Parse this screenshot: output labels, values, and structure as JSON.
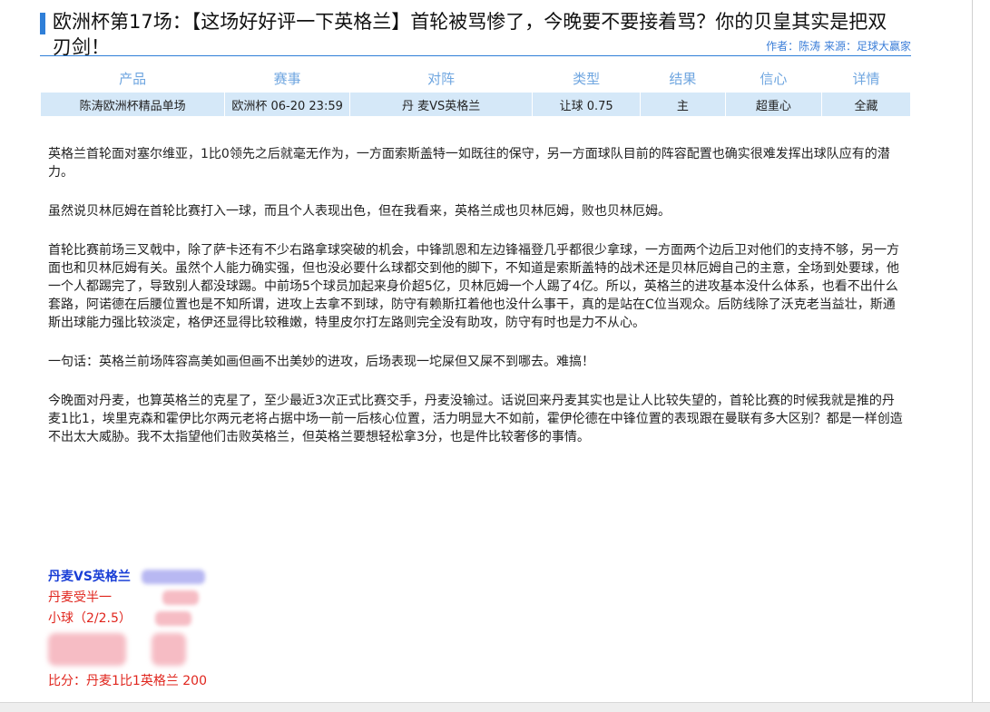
{
  "article": {
    "title": "欧洲杯第17场：【这场好好评一下英格兰】首轮被骂惨了，今晚要不要接着骂？你的贝皇其实是把双刃剑！",
    "byline": "作者：陈涛 来源：足球大赢家"
  },
  "table": {
    "headers": [
      "产品",
      "赛事",
      "对阵",
      "类型",
      "结果",
      "信心",
      "详情"
    ],
    "row": [
      "陈涛欧洲杯精品单场",
      "欧洲杯 06-20 23:59",
      "丹 麦VS英格兰",
      "让球 0.75",
      "主",
      "超重心",
      "全藏"
    ]
  },
  "body": {
    "paragraphs": [
      "英格兰首轮面对塞尔维亚，1比0领先之后就毫无作为，一方面索斯盖特一如既往的保守，另一方面球队目前的阵容配置也确实很难发挥出球队应有的潜力。",
      "虽然说贝林厄姆在首轮比赛打入一球，而且个人表现出色，但在我看来，英格兰成也贝林厄姆，败也贝林厄姆。",
      "首轮比赛前场三叉戟中，除了萨卡还有不少右路拿球突破的机会，中锋凯恩和左边锋福登几乎都很少拿球，一方面两个边后卫对他们的支持不够，另一方面也和贝林厄姆有关。虽然个人能力确实强，但也没必要什么球都交到他的脚下，不知道是索斯盖特的战术还是贝林厄姆自己的主意，全场到处要球，他一个人都踢完了，导致别人都没球踢。中前场5个球员加起来身价超5亿，贝林厄姆一个人踢了4亿。所以，英格兰的进攻基本没什么体系，也看不出什么套路，阿诺德在后腰位置也是不知所谓，进攻上去拿不到球，防守有赖斯扛着他也没什么事干，真的是站在C位当观众。后防线除了沃克老当益壮，斯通斯出球能力强比较淡定，格伊还显得比较稚嫩，特里皮尔打左路则完全没有助攻，防守有时也是力不从心。",
      "一句话：英格兰前场阵容高美如画但画不出美妙的进攻，后场表现一坨屎但又屎不到哪去。难搞！",
      "今晚面对丹麦，也算英格兰的克星了，至少最近3次正式比赛交手，丹麦没输过。话说回来丹麦其实也是让人比较失望的，首轮比赛的时候我就是推的丹麦1比1，埃里克森和霍伊比尔两元老将占据中场一前一后核心位置，活力明显大不如前，霍伊伦德在中锋位置的表现跟在曼联有多大区别？都是一样创造不出太大威胁。我不太指望他们击败英格兰，但英格兰要想轻松拿3分，也是件比较奢侈的事情。"
    ]
  },
  "pick": {
    "match": "丹麦VS英格兰",
    "handicap": "丹麦受半一",
    "total": "小球（2/2.5）",
    "score": "比分：丹麦1比1英格兰 200"
  },
  "colors": {
    "accent": "#2f7fd8",
    "header_text": "#6fa6e0",
    "row_bg": "#d5e8f8",
    "pick_blue": "#1a3fd6",
    "pick_red": "#e0261e"
  }
}
